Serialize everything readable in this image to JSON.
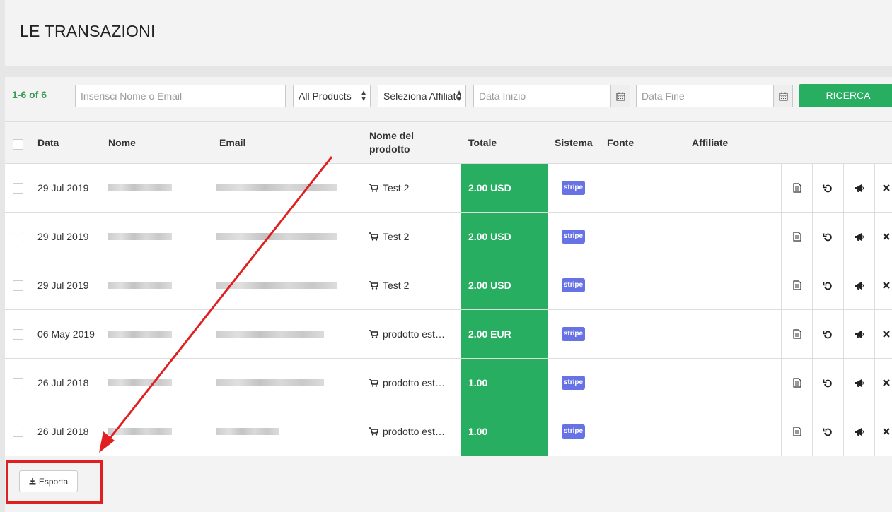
{
  "page": {
    "title": "LE TRANSAZIONI"
  },
  "filters": {
    "count": "1-6 of 6",
    "search_placeholder": "Inserisci Nome o Email",
    "product_select": "All Products",
    "affiliate_select": "Seleziona Affiliato",
    "start_date_placeholder": "Data Inizio",
    "end_date_placeholder": "Data Fine",
    "search_button": "RICERCA"
  },
  "table": {
    "headers": {
      "date": "Data",
      "name": "Nome",
      "email": "Email",
      "product_line1": "Nome del",
      "product_line2": "prodotto",
      "total": "Totale",
      "system": "Sistema",
      "source": "Fonte",
      "affiliate": "Affiliate"
    },
    "rows": [
      {
        "date": "29 Jul 2019",
        "product": "Test 2",
        "total": "2.00 USD",
        "system": "stripe"
      },
      {
        "date": "29 Jul 2019",
        "product": "Test 2",
        "total": "2.00 USD",
        "system": "stripe"
      },
      {
        "date": "29 Jul 2019",
        "product": "Test 2",
        "total": "2.00 USD",
        "system": "stripe"
      },
      {
        "date": "06 May 2019",
        "product": "prodotto est…",
        "total": "2.00 EUR",
        "system": "stripe"
      },
      {
        "date": "26 Jul 2018",
        "product": "prodotto est…",
        "total": "1.00",
        "system": "stripe"
      },
      {
        "date": "26 Jul 2018",
        "product": "prodotto est…",
        "total": "1.00",
        "system": "stripe"
      }
    ]
  },
  "export": {
    "label": "Esporta"
  },
  "colors": {
    "accent_green": "#27ae60",
    "stripe_purple": "#6772e5",
    "annotation_red": "#e02020"
  },
  "icons": [
    "calendar-icon",
    "cart-icon",
    "document-icon",
    "refund-icon",
    "megaphone-icon",
    "close-icon",
    "download-icon"
  ]
}
